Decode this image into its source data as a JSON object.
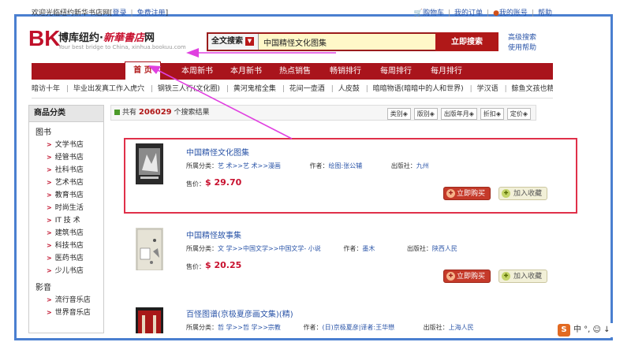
{
  "topbar": {
    "welcome": "欢迎光临纽约新华书店网",
    "login": "登录",
    "register": "免费注册",
    "cart": "购物车",
    "orders": "我的订单",
    "account": "我的账号",
    "help": "帮助"
  },
  "logo": {
    "mark": "BK",
    "name": "博库纽约·",
    "calligraphy": "新華書店",
    "suffix": "网",
    "subtitle": "Your best bridge to China, xinhua.bookuu.com"
  },
  "search": {
    "type": "全文搜索",
    "query": "中国精怪文化图集",
    "button": "立即搜索",
    "advanced": "高级搜索",
    "help": "使用帮助"
  },
  "nav": {
    "items": [
      "首 页",
      "本周新书",
      "本月新书",
      "热点销售",
      "畅销排行",
      "每周排行",
      "每月排行"
    ]
  },
  "subnav": {
    "items": [
      "暗访十年",
      "毕业出发真工作入虎穴",
      "钢铁三人行(文化圈)",
      "黄河鬼棺全集",
      "花间一壶酒",
      "人皮鼓",
      "暗暗物语(暗暗中的人和世界)",
      "学汉语",
      "鲸鱼文孩也精男孩"
    ]
  },
  "sidebar": {
    "header": "商品分类",
    "groups": [
      {
        "label": "图书",
        "items": [
          "文学书店",
          "经管书店",
          "社科书店",
          "艺术书店",
          "教育书店",
          "时尚生活",
          "IT 技 术",
          "建筑书店",
          "科技书店",
          "医药书店",
          "少儿书店"
        ]
      },
      {
        "label": "影音",
        "items": [
          "流行音乐店",
          "世界音乐店"
        ]
      }
    ]
  },
  "results": {
    "prefix": "共有",
    "count": "206029",
    "suffix": "个搜索结果",
    "sort": [
      "类别",
      "版别",
      "出版年月",
      "折扣",
      "定价"
    ]
  },
  "labels": {
    "category": "所属分类：",
    "author": "作者：",
    "publisher": "出版社：",
    "price": "售价：",
    "buy": "立即购买",
    "fav": "加入收藏"
  },
  "products": [
    {
      "title": "中国精怪文化图集",
      "category": "艺 术>>艺 术>>漫画",
      "author": "绘图:张公辅",
      "publisher": "九州",
      "price": "$ 29.70"
    },
    {
      "title": "中国精怪故事集",
      "category": "文 学>>中国文学>>中国文学- 小说",
      "author": "墨木",
      "publisher": "陕西人民",
      "price": "$ 20.25"
    },
    {
      "title": "百怪图谱(京极夏彦画文集)(精)",
      "category": "哲 学>>哲 学>>宗教",
      "author": "(日)京极夏彦|译者:王华懋",
      "publisher": "上海人民",
      "price": ""
    }
  ],
  "ime": {
    "s": "S",
    "text": "中 °, ☺ ↓"
  },
  "colors": {
    "brand_red": "#a9141c",
    "link_blue": "#2b55a8",
    "price_red": "#c8102e",
    "frame_blue": "#4a7fd0",
    "annotation_magenta": "#e040e0"
  }
}
